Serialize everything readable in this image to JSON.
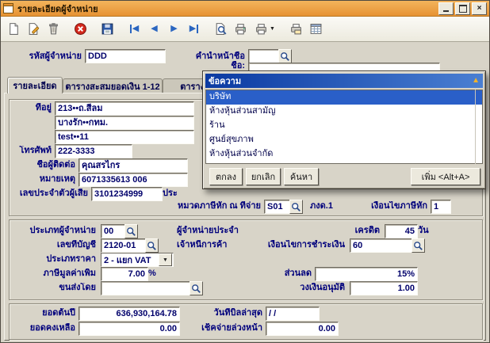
{
  "window": {
    "title": "รายละเอียดผู้จำหน่าย"
  },
  "icons": {
    "close_window": "×",
    "arrow_left": "◀",
    "arrow_right": "▶",
    "triangle_down": "▼",
    "triangle_up": "▲"
  },
  "toolbar": {
    "buttons": [
      "new",
      "edit",
      "delete",
      "cancel",
      "save",
      "first",
      "previous",
      "next",
      "last",
      "preview",
      "print",
      "print-options",
      "print-setup",
      "browse"
    ]
  },
  "header": {
    "vendor_code_label": "รหัสผู้จำหน่าย",
    "vendor_code": "DDD",
    "prefix_label": "คำนำหน้าชื่อ",
    "prefix": "",
    "name_label": "ชื่อ:",
    "name": ""
  },
  "tabs": {
    "tab1": "รายละเอียด",
    "tab2": "ตารางสะสมยอดเงิน 1-12",
    "tab3": "ตารางสะสมยอด"
  },
  "details": {
    "address_label": "ที่อยู่",
    "address1": "213••ถ.สีลม",
    "address2": "บางรัก••กทม.",
    "address3": "test••11",
    "phone_label": "โทรศัพท์",
    "phone": "222-3333",
    "contact_label": "ชื่อผู้ติดต่อ",
    "contact": "คุณสรไกร",
    "note_label": "หมายเหตุ",
    "note": "6071335613 006",
    "taxid_label": "เลขประจำตัวผู้เสีย",
    "taxid": "3101234999",
    "clipped_label": "ประ",
    "wht_label": "หมวดภาษีหัก ณ ที่จ่าย",
    "wht_code": "S01",
    "wht_form": "ภงด.1",
    "wht_cond_label": "เงื่อนไขภาษีหัก",
    "wht_cond": "1"
  },
  "business": {
    "vendor_type_label": "ประเภทผู้จำหน่าย",
    "vendor_type": "00",
    "regular_label": "ผู้จำหน่ายประจำ",
    "credit_label": "เครดิต",
    "credit_days": "45",
    "days_label": "วัน",
    "account_label": "เลขที่บัญชี",
    "account": "2120-01",
    "payable_label": "เจ้าหนี้การค้า",
    "pay_cond_label": "เงื่อนไขการชำระเงิน",
    "pay_cond": "60",
    "price_type_label": "ประเภทราคา",
    "price_type": "2 - แยก VAT",
    "vat_label": "ภาษีมูลค่าเพิ่ม",
    "vat": "7.00",
    "percent_label": "%",
    "transport_label": "ขนส่งโดย",
    "transport": "",
    "discount_label": "ส่วนลด",
    "discount": "15%",
    "credit_limit_label": "วงเงินอนุมัติ",
    "credit_limit": "1.00"
  },
  "totals": {
    "begin_label": "ยอดต้นปี",
    "begin": "636,930,164.78",
    "last_bill_label": "วันที่บิลล่าสุด",
    "last_bill": "/  /",
    "balance_label": "ยอดคงเหลือ",
    "balance": "0.00",
    "advance_label": "เช็คจ่ายล่วงหน้า",
    "advance": "0.00"
  },
  "popup": {
    "title": "ข้อความ",
    "items": [
      "บริษัท",
      "ห้างหุ้นส่วนสามัญ",
      "ร้าน",
      "ศูนย์สุขภาพ",
      "ห้างหุ้นส่วนจำกัด"
    ],
    "ok": "ตกลง",
    "cancel": "ยกเลิก",
    "search": "ค้นหา",
    "add": "เพิ่ม <Alt+A>"
  }
}
